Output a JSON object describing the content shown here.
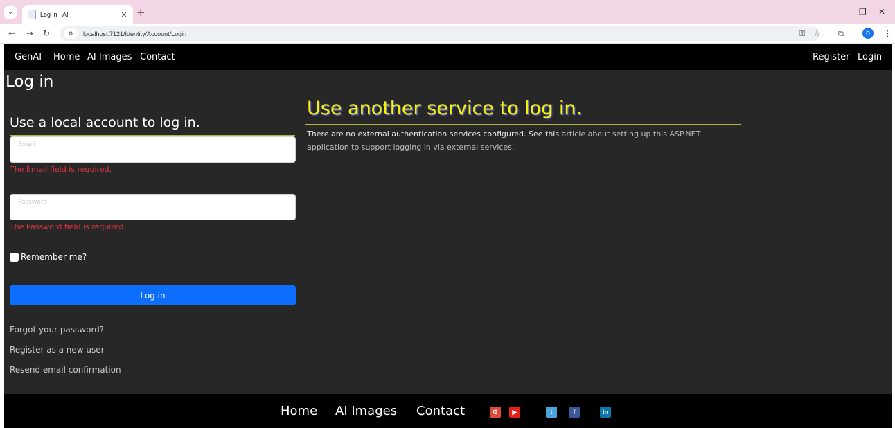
{
  "browser": {
    "tab_title": "Log in - AI",
    "url": "localhost:7121/Identity/Account/Login",
    "profile_initial": "D"
  },
  "navbar": {
    "brand": "GenAI",
    "links": [
      "Home",
      "AI Images",
      "Contact"
    ],
    "right": [
      "Register",
      "Login"
    ]
  },
  "login": {
    "heading": "Log in",
    "subheading": "Use a local account to log in.",
    "email_placeholder": "Email",
    "email_error": "The Email field is required.",
    "password_placeholder": "Password",
    "password_error": "The Password field is required.",
    "remember_label": "Remember me?",
    "button_label": "Log in",
    "links": [
      "Forgot your password?",
      "Register as a new user",
      "Resend email confirmation"
    ]
  },
  "external": {
    "heading": "Use another service to log in.",
    "text_before": "There are no external authentication services configured. See this ",
    "link_text": "article about setting up this ASP.NET application to support logging in via external services",
    "text_after": "."
  },
  "footer": {
    "links": [
      "Home",
      "AI Images",
      "Contact"
    ],
    "social": [
      {
        "icon": "google-icon",
        "glyph": "G",
        "color": "#dd4b39"
      },
      {
        "icon": "youtube-icon",
        "glyph": "▶",
        "color": "#e62117"
      },
      {
        "icon": "twitter-icon",
        "glyph": "t",
        "color": "#4aa3df"
      },
      {
        "icon": "facebook-icon",
        "glyph": "f",
        "color": "#3b5998"
      },
      {
        "icon": "linkedin-icon",
        "glyph": "in",
        "color": "#0e76a8"
      }
    ]
  }
}
